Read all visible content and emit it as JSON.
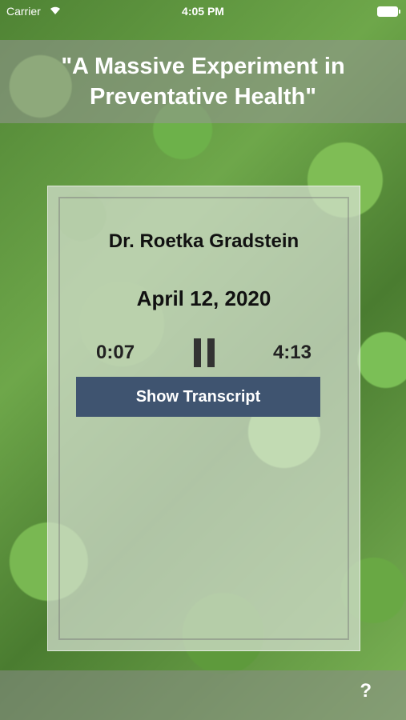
{
  "status_bar": {
    "carrier": "Carrier",
    "time": "4:05 PM"
  },
  "header": {
    "title": "\"A Massive Experiment in Preventative Health\""
  },
  "player": {
    "speaker": "Dr. Roetka Gradstein",
    "date": "April 12, 2020",
    "elapsed": "0:07",
    "duration": "4:13",
    "state": "playing",
    "transcript_button_label": "Show Transcript"
  },
  "footer": {
    "help_label": "?"
  },
  "colors": {
    "button_bg": "#3f5470",
    "title_text": "#ffffff"
  }
}
